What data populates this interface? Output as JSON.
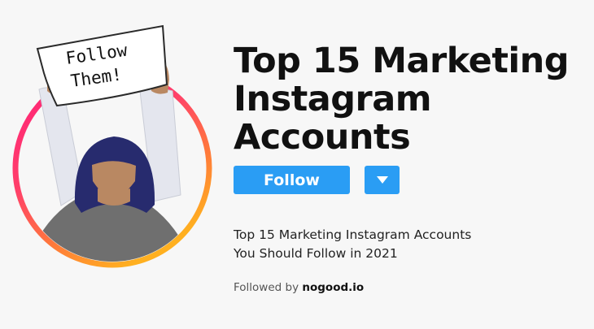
{
  "sign": {
    "line1": "Follow",
    "line2": "Them!"
  },
  "headline": {
    "line1": "Top 15 Marketing",
    "line2": "Instagram",
    "line3": "Accounts"
  },
  "actions": {
    "follow_label": "Follow",
    "dropdown_icon": "triangle-down-icon"
  },
  "description": {
    "line1": "Top 15 Marketing Instagram Accounts",
    "line2": "You Should Follow in 2021"
  },
  "followed_by": {
    "prefix": "Followed by",
    "account": "nogood.io"
  },
  "colors": {
    "accent": "#2a9df4",
    "ring_start": "#ff2d8a",
    "ring_end": "#ffb020",
    "background": "#f7f7f7"
  }
}
